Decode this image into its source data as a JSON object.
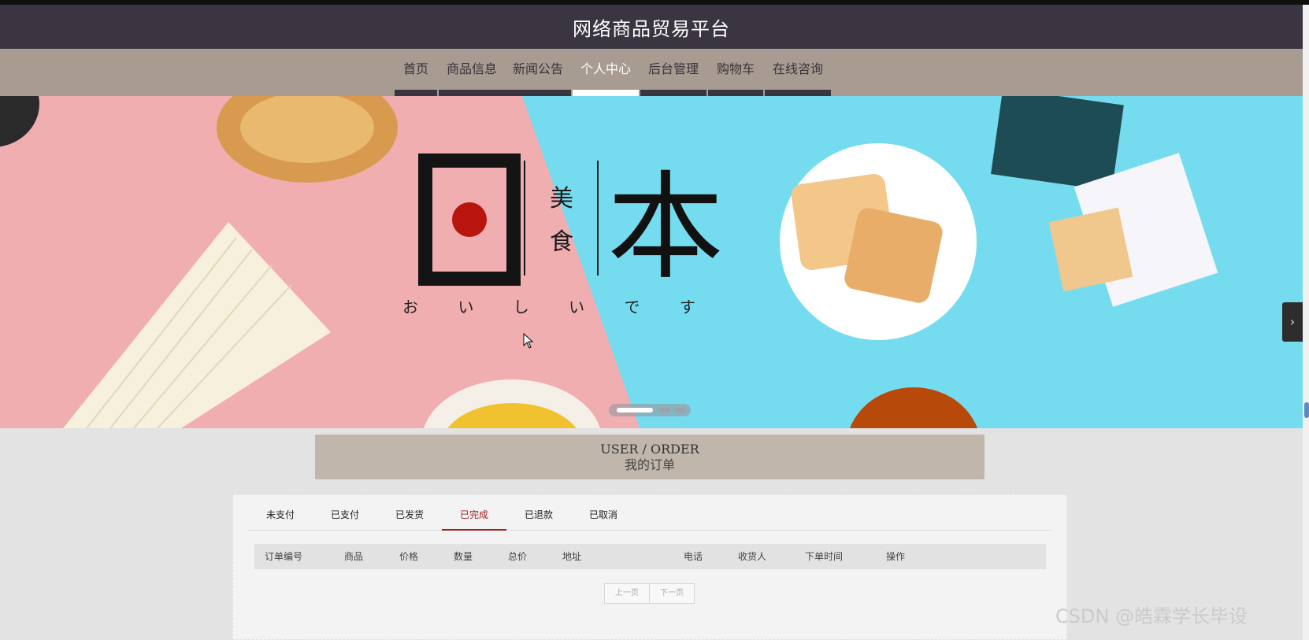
{
  "header": {
    "title": "网络商品贸易平台"
  },
  "nav": {
    "items": [
      {
        "label": "首页"
      },
      {
        "label": "商品信息"
      },
      {
        "label": "新闻公告"
      },
      {
        "label": "个人中心",
        "active": true
      },
      {
        "label": "后台管理"
      },
      {
        "label": "购物车"
      },
      {
        "label": "在线咨询"
      }
    ]
  },
  "banner": {
    "big_char_left": "日",
    "big_char_right": "本",
    "small_chars": [
      "美",
      "食"
    ],
    "subtitle": "お い し い で す",
    "next_icon": "chevron-right-icon",
    "slides_count": 3,
    "active_slide": 1,
    "colors": {
      "pink": "#f1aeb1",
      "cyan": "#75dcef",
      "red_sun": "#b8150f"
    }
  },
  "section": {
    "title_en": "USER / ORDER",
    "title_zh": "我的订单"
  },
  "order_tabs": {
    "items": [
      {
        "label": "未支付"
      },
      {
        "label": "已支付"
      },
      {
        "label": "已发货"
      },
      {
        "label": "已完成",
        "active": true
      },
      {
        "label": "已退款"
      },
      {
        "label": "已取消"
      }
    ]
  },
  "table": {
    "columns": [
      "订单编号",
      "商品",
      "价格",
      "数量",
      "总价",
      "地址",
      "电话",
      "收货人",
      "下单时间",
      "操作"
    ]
  },
  "pager": {
    "prev": "上一页",
    "next": "下一页"
  },
  "watermark": "CSDN @皓霖学长毕设",
  "colors": {
    "header_bg": "#3a3541",
    "nav_bg": "#a89b92",
    "accent": "#9b1f1a",
    "title_box_bg": "#c0b6ab"
  }
}
